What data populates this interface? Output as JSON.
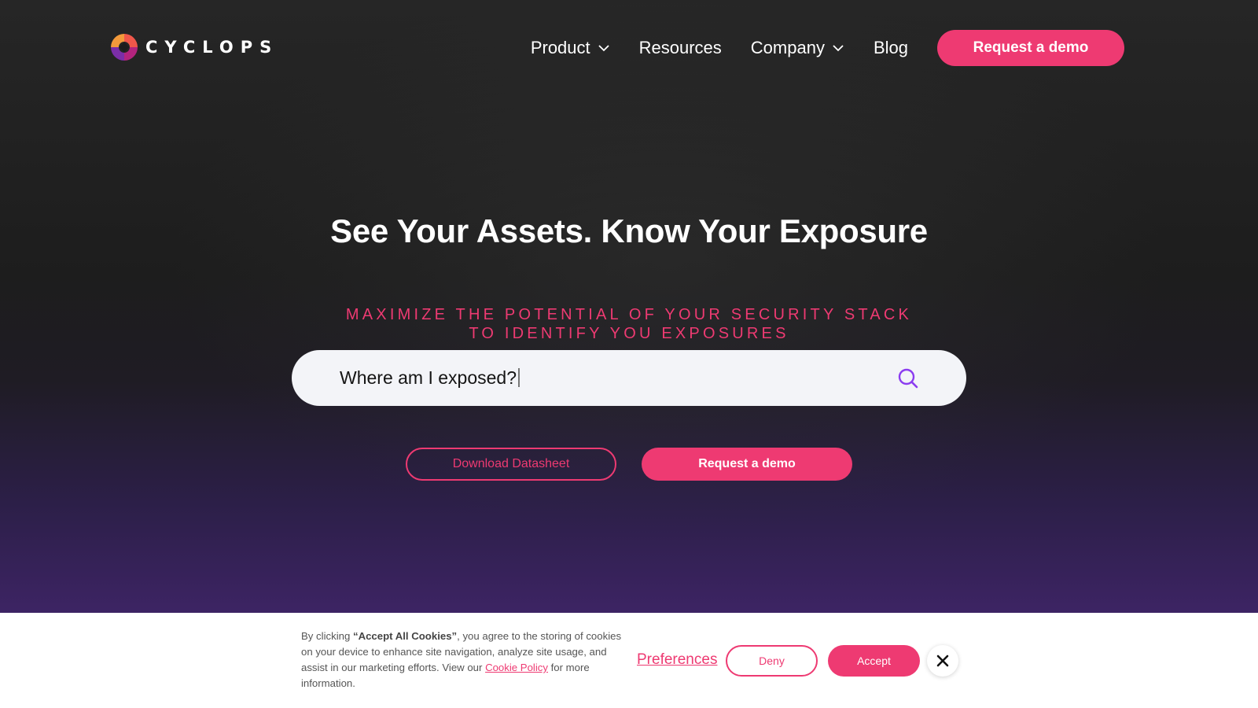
{
  "header": {
    "logo_text": "CYCLOPS",
    "nav": [
      {
        "label": "Product",
        "has_dropdown": true,
        "icon": "chevron-down-icon"
      },
      {
        "label": "Resources",
        "has_dropdown": false
      },
      {
        "label": "Company",
        "has_dropdown": true,
        "icon": "chevron-down-icon"
      },
      {
        "label": "Blog",
        "has_dropdown": false
      }
    ],
    "cta_label": "Request a demo"
  },
  "hero": {
    "headline": "See Your Assets. Know Your Exposure",
    "subheadline_line1": "MAXIMIZE THE POTENTIAL OF YOUR SECURITY STACK",
    "subheadline_line2": "TO IDENTIFY YOU EXPOSURES",
    "search": {
      "value": "Where am I exposed?",
      "icon": "search-icon"
    },
    "secondary_button": "Download Datasheet",
    "primary_button": "Request a demo"
  },
  "cookie_banner": {
    "text_prefix": "By clicking ",
    "text_bold": "“Accept All Cookies”",
    "text_middle": ", you agree to the storing of cookies on your device to enhance site navigation, analyze site usage, and assist in our marketing efforts. View our ",
    "link_label": "Cookie Policy",
    "text_suffix": " for more information.",
    "preferences_label": "Preferences",
    "deny_label": "Deny",
    "accept_label": "Accept",
    "close_icon": "close-icon"
  },
  "colors": {
    "accent": "#ee3a72",
    "background_dark": "#202020",
    "gradient_purple": "#3d2464",
    "search_icon": "#8b3cf0"
  }
}
